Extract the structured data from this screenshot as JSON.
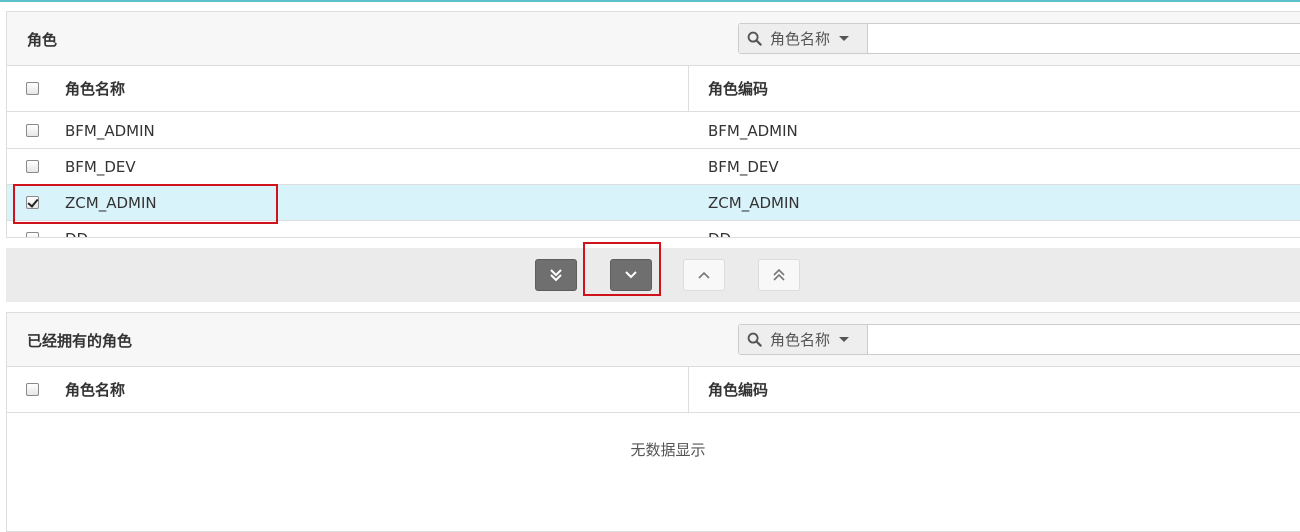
{
  "colors": {
    "accent_line": "#5bc0c8",
    "selected_row_bg": "#d9f3fa",
    "highlight_border": "#d0121c",
    "dark_button": "#6f6f6f"
  },
  "top_panel": {
    "title": "角色",
    "search": {
      "field_label": "角色名称",
      "placeholder": "",
      "value": ""
    },
    "columns": [
      "角色名称",
      "角色编码"
    ],
    "rows": [
      {
        "name": "BFM_ADMIN",
        "code": "BFM_ADMIN",
        "checked": false
      },
      {
        "name": "BFM_DEV",
        "code": "BFM_DEV",
        "checked": false
      },
      {
        "name": "ZCM_ADMIN",
        "code": "ZCM_ADMIN",
        "checked": true
      },
      {
        "name": "DD",
        "code": "DD",
        "checked": false
      }
    ]
  },
  "toolbar": {
    "buttons": [
      {
        "name": "move-all-down",
        "icon": "double-chevron-down-icon"
      },
      {
        "name": "move-selected-down",
        "icon": "chevron-down-icon"
      },
      {
        "name": "move-selected-up",
        "icon": "chevron-up-icon"
      },
      {
        "name": "move-all-up",
        "icon": "double-chevron-up-icon"
      }
    ]
  },
  "bottom_panel": {
    "title": "已经拥有的角色",
    "search": {
      "field_label": "角色名称",
      "placeholder": "",
      "value": ""
    },
    "columns": [
      "角色名称",
      "角色编码"
    ],
    "empty_message": "无数据显示"
  }
}
